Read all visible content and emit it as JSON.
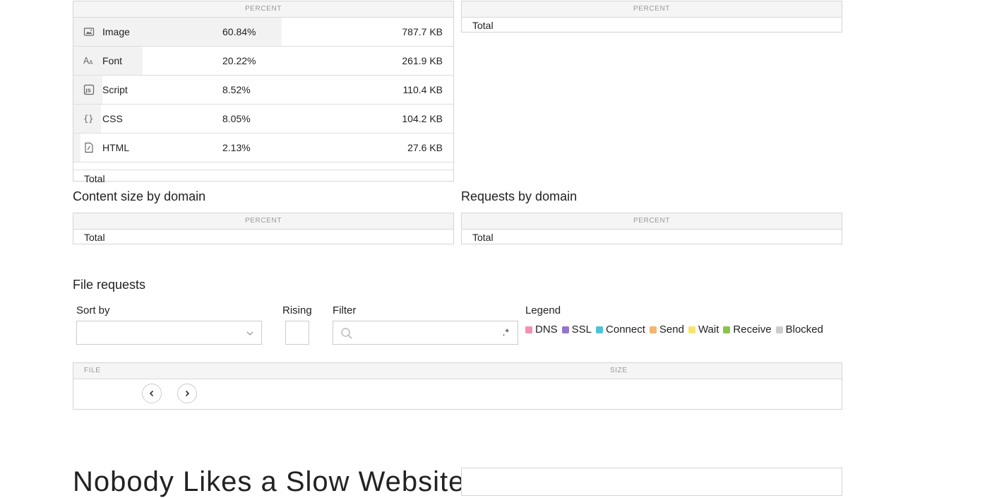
{
  "type_table": {
    "header": "PERCENT",
    "rows": [
      {
        "name": "Image",
        "percent": "60.84%",
        "size": "787.7 KB",
        "share": 0.6084,
        "icon": "image-icon"
      },
      {
        "name": "Font",
        "percent": "20.22%",
        "size": "261.9 KB",
        "share": 0.2022,
        "icon": "font-icon"
      },
      {
        "name": "Script",
        "percent": "8.52%",
        "size": "110.4 KB",
        "share": 0.0852,
        "icon": "script-icon"
      },
      {
        "name": "CSS",
        "percent": "8.05%",
        "size": "104.2 KB",
        "share": 0.0805,
        "icon": "css-icon"
      },
      {
        "name": "HTML",
        "percent": "2.13%",
        "size": "27.6 KB",
        "share": 0.0213,
        "icon": "html-icon"
      }
    ],
    "total_label": "Total"
  },
  "right_top_table": {
    "header": "PERCENT",
    "total_label": "Total"
  },
  "content_by_domain": {
    "title": "Content size by domain",
    "header": "PERCENT",
    "total_label": "Total"
  },
  "requests_by_domain": {
    "title": "Requests by domain",
    "header": "PERCENT",
    "total_label": "Total"
  },
  "file_requests": {
    "title": "File requests",
    "sort_by_label": "Sort by",
    "rising_label": "Rising",
    "filter_label": "Filter",
    "filter_regex": ".*",
    "legend_label": "Legend",
    "legend": [
      {
        "name": "DNS",
        "color": "#f48fb1"
      },
      {
        "name": "SSL",
        "color": "#9575cd"
      },
      {
        "name": "Connect",
        "color": "#4fc3d7"
      },
      {
        "name": "Send",
        "color": "#f5b66e"
      },
      {
        "name": "Wait",
        "color": "#f7e36b"
      },
      {
        "name": "Receive",
        "color": "#8bc34a"
      },
      {
        "name": "Blocked",
        "color": "#cccccc"
      }
    ],
    "table": {
      "file_header": "FILE",
      "size_header": "SIZE"
    }
  },
  "bottom": {
    "headline": "Nobody Likes a Slow Website"
  }
}
